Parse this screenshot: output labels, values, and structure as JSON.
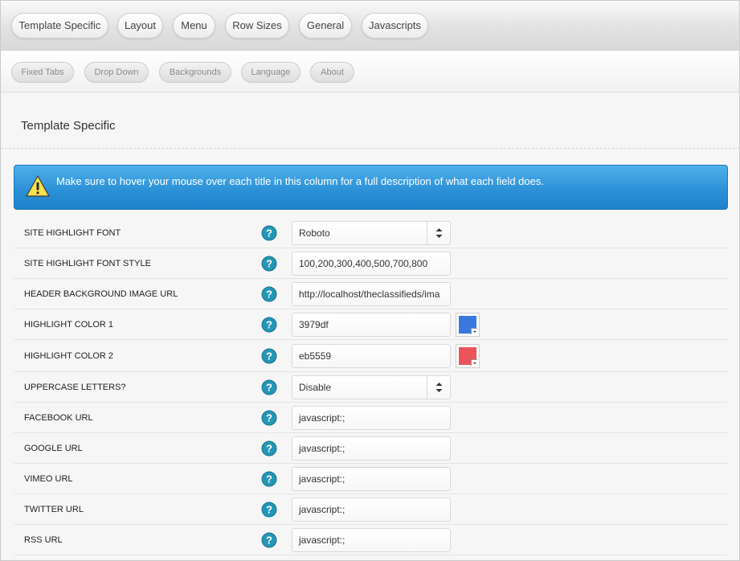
{
  "tabs": [
    {
      "label": "Template Specific"
    },
    {
      "label": "Layout"
    },
    {
      "label": "Menu"
    },
    {
      "label": "Row Sizes"
    },
    {
      "label": "General"
    },
    {
      "label": "Javascripts"
    }
  ],
  "subtabs": [
    {
      "label": "Fixed Tabs"
    },
    {
      "label": "Drop Down"
    },
    {
      "label": "Backgrounds"
    },
    {
      "label": "Language"
    },
    {
      "label": "About"
    }
  ],
  "section_title": "Template Specific",
  "alert": {
    "icon": "warning-icon",
    "text": "Make sure to hover your mouse over each title in this column for a full description of what each field does."
  },
  "fields": [
    {
      "label": "SITE HIGHLIGHT FONT",
      "type": "select",
      "value": "Roboto"
    },
    {
      "label": "SITE HIGHLIGHT FONT STYLE",
      "type": "text",
      "value": "100,200,300,400,500,700,800"
    },
    {
      "label": "HEADER BACKGROUND IMAGE URL",
      "type": "text",
      "value": "http://localhost/theclassifieds/ima"
    },
    {
      "label": "HIGHLIGHT COLOR 1",
      "type": "color",
      "value": "3979df",
      "swatch": "#3979df"
    },
    {
      "label": "HIGHLIGHT COLOR 2",
      "type": "color",
      "value": "eb5559",
      "swatch": "#eb5559"
    },
    {
      "label": "UPPERCASE LETTERS?",
      "type": "select",
      "value": "Disable"
    },
    {
      "label": "FACEBOOK URL",
      "type": "text",
      "value": "javascript:;"
    },
    {
      "label": "GOOGLE URL",
      "type": "text",
      "value": "javascript:;"
    },
    {
      "label": "VIMEO URL",
      "type": "text",
      "value": "javascript:;"
    },
    {
      "label": "TWITTER URL",
      "type": "text",
      "value": "javascript:;"
    },
    {
      "label": "RSS URL",
      "type": "text",
      "value": "javascript:;"
    }
  ],
  "colors": {
    "help_icon": "#2596b5",
    "alert": "#2a8fd6"
  }
}
